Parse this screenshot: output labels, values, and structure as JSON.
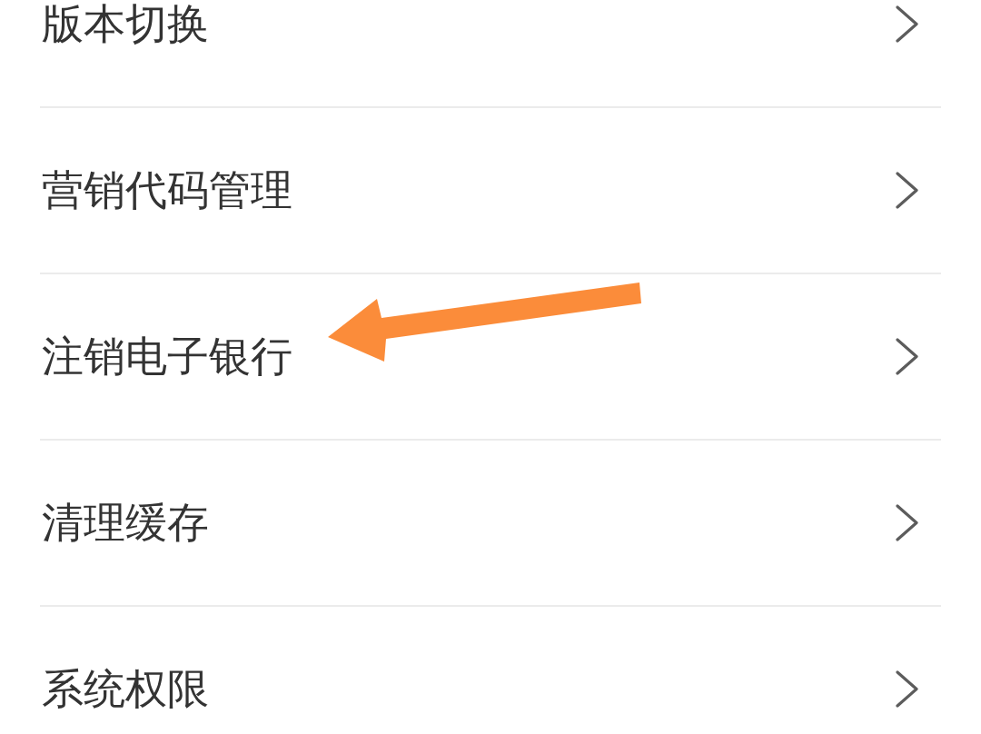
{
  "settings_list": [
    {
      "label": "版本切换",
      "annotated": false
    },
    {
      "label": "营销代码管理",
      "annotated": false
    },
    {
      "label": "注销电子银行",
      "annotated": true
    },
    {
      "label": "清理缓存",
      "annotated": false
    },
    {
      "label": "系统权限",
      "annotated": false
    }
  ]
}
